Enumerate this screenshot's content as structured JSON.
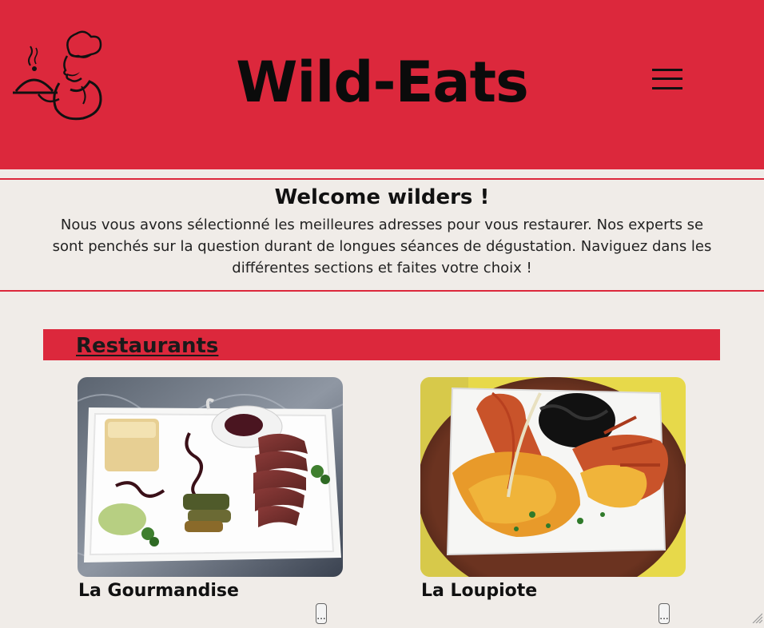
{
  "header": {
    "title": "Wild-Eats",
    "logo_icon": "chef-serving-dish-logo",
    "menu_icon": "hamburger-menu-icon",
    "background": "#dc283c"
  },
  "intro": {
    "heading": "Welcome wilders !",
    "text": "Nous vous avons sélectionné les meilleures adresses pour vous restaurer. Nos experts se sont penchés sur la question durant de longues séances de dégustation. Naviguez dans les différentes sections et faites votre choix !"
  },
  "section": {
    "title": "Restaurants"
  },
  "restaurants": [
    {
      "name": "La Gourmandise",
      "more_label": "...",
      "image": "duck-breast-plate-photo"
    },
    {
      "name": "La Loupiote",
      "more_label": "...",
      "image": "lobster-plate-photo"
    }
  ],
  "colors": {
    "accent": "#dc283c",
    "page_background": "#f0ece8",
    "text": "#111111"
  }
}
